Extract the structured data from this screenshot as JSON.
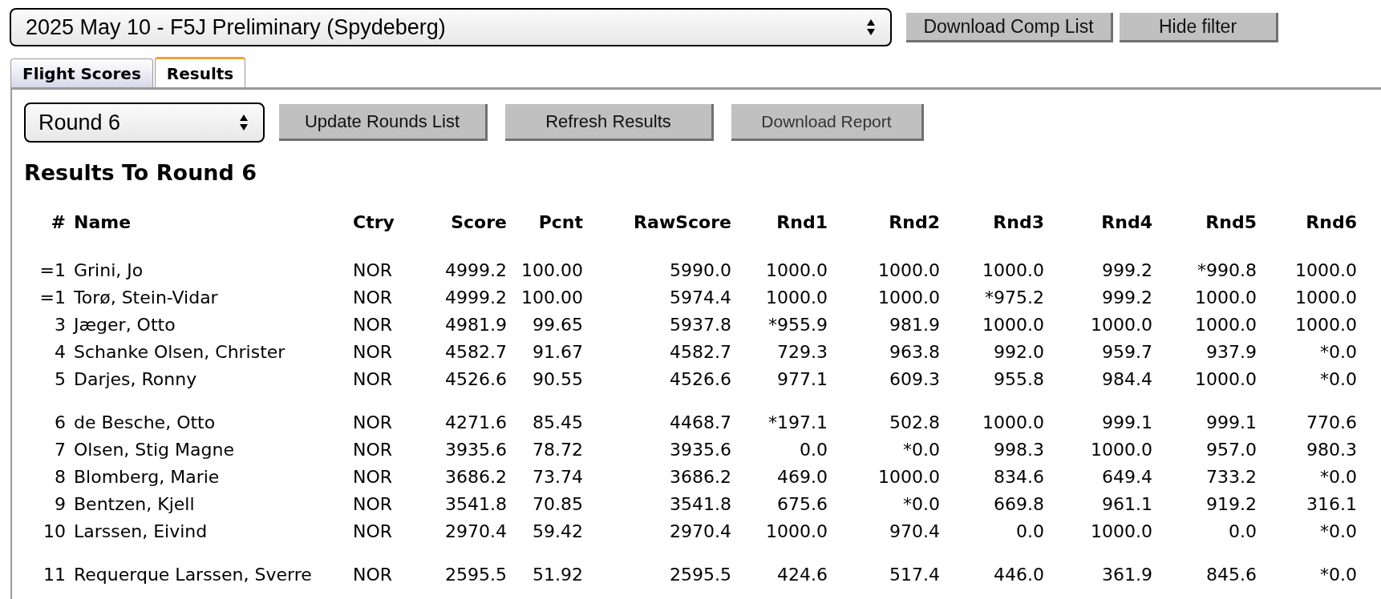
{
  "competition_select": {
    "value": "2025 May 10 - F5J Preliminary (Spydeberg)"
  },
  "top_buttons": [
    "Download Comp List",
    "Hide filter"
  ],
  "tabs": [
    {
      "label": "Flight Scores",
      "selected": false
    },
    {
      "label": "Results",
      "selected": true
    }
  ],
  "round_select": {
    "value": "Round 6"
  },
  "action_buttons": [
    "Update Rounds List",
    "Refresh Results",
    "Download Report"
  ],
  "heading": "Results To Round 6",
  "table": {
    "columns": [
      "#",
      "Name",
      "Ctry",
      "Score",
      "Pcnt",
      "RawScore",
      "Rnd1",
      "Rnd2",
      "Rnd3",
      "Rnd4",
      "Rnd5",
      "Rnd6"
    ],
    "groups": [
      [
        [
          "=1",
          "Grini, Jo",
          "NOR",
          "4999.2",
          "100.00",
          "5990.0",
          "1000.0",
          "1000.0",
          "1000.0",
          "999.2",
          "*990.8",
          "1000.0"
        ],
        [
          "=1",
          "Torø, Stein-Vidar",
          "NOR",
          "4999.2",
          "100.00",
          "5974.4",
          "1000.0",
          "1000.0",
          "*975.2",
          "999.2",
          "1000.0",
          "1000.0"
        ],
        [
          "3",
          "Jæger, Otto",
          "NOR",
          "4981.9",
          "99.65",
          "5937.8",
          "*955.9",
          "981.9",
          "1000.0",
          "1000.0",
          "1000.0",
          "1000.0"
        ],
        [
          "4",
          "Schanke Olsen, Christer",
          "NOR",
          "4582.7",
          "91.67",
          "4582.7",
          "729.3",
          "963.8",
          "992.0",
          "959.7",
          "937.9",
          "*0.0"
        ],
        [
          "5",
          "Darjes, Ronny",
          "NOR",
          "4526.6",
          "90.55",
          "4526.6",
          "977.1",
          "609.3",
          "955.8",
          "984.4",
          "1000.0",
          "*0.0"
        ]
      ],
      [
        [
          "6",
          "de Besche, Otto",
          "NOR",
          "4271.6",
          "85.45",
          "4468.7",
          "*197.1",
          "502.8",
          "1000.0",
          "999.1",
          "999.1",
          "770.6"
        ],
        [
          "7",
          "Olsen, Stig Magne",
          "NOR",
          "3935.6",
          "78.72",
          "3935.6",
          "0.0",
          "*0.0",
          "998.3",
          "1000.0",
          "957.0",
          "980.3"
        ],
        [
          "8",
          "Blomberg, Marie",
          "NOR",
          "3686.2",
          "73.74",
          "3686.2",
          "469.0",
          "1000.0",
          "834.6",
          "649.4",
          "733.2",
          "*0.0"
        ],
        [
          "9",
          "Bentzen, Kjell",
          "NOR",
          "3541.8",
          "70.85",
          "3541.8",
          "675.6",
          "*0.0",
          "669.8",
          "961.1",
          "919.2",
          "316.1"
        ],
        [
          "10",
          "Larssen, Eivind",
          "NOR",
          "2970.4",
          "59.42",
          "2970.4",
          "1000.0",
          "970.4",
          "0.0",
          "1000.0",
          "0.0",
          "*0.0"
        ]
      ],
      [
        [
          "11",
          "Requerque Larssen, Sverre",
          "NOR",
          "2595.5",
          "51.92",
          "2595.5",
          "424.6",
          "517.4",
          "446.0",
          "361.9",
          "845.6",
          "*0.0"
        ]
      ]
    ]
  }
}
